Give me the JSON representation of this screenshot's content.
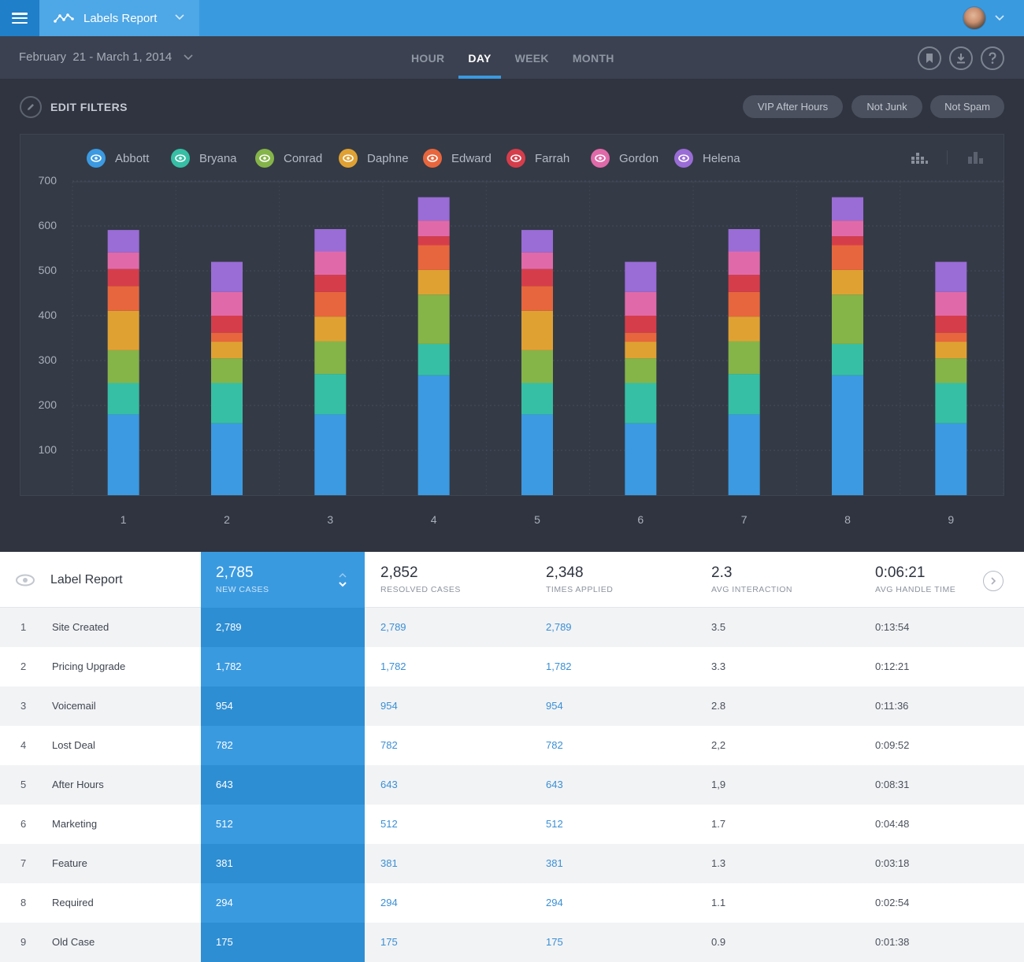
{
  "header": {
    "report_title": "Labels Report"
  },
  "subbar": {
    "date_range": "February  21 - March 1, 2014",
    "tabs": [
      {
        "label": "HOUR",
        "active": false
      },
      {
        "label": "DAY",
        "active": true
      },
      {
        "label": "WEEK",
        "active": false
      },
      {
        "label": "MONTH",
        "active": false
      }
    ],
    "icons": [
      "bookmark-icon",
      "download-icon",
      "help-icon"
    ]
  },
  "filters": {
    "edit_label": "EDIT FILTERS",
    "chips": [
      "VIP After Hours",
      "Not Junk",
      "Not Spam"
    ]
  },
  "colors": {
    "accent": "#3a9ae0",
    "series": [
      "#3b9ae1",
      "#36bfa4",
      "#85b449",
      "#e0a133",
      "#e8663d",
      "#d63d4b",
      "#e06aa9",
      "#9a6cd6"
    ]
  },
  "chart_data": {
    "type": "bar",
    "stacked": true,
    "categories": [
      "1",
      "2",
      "3",
      "4",
      "5",
      "6",
      "7",
      "8",
      "9"
    ],
    "ylim": [
      0,
      800
    ],
    "yticks": [
      100,
      200,
      300,
      400,
      500,
      600,
      700
    ],
    "grid": true,
    "legend_position": "top-left",
    "series": [
      {
        "name": "Abbott",
        "values": [
          180,
          160,
          180,
          267,
          180,
          160,
          180,
          267,
          160
        ]
      },
      {
        "name": "Bryana",
        "values": [
          70,
          90,
          90,
          70,
          70,
          90,
          90,
          70,
          90
        ]
      },
      {
        "name": "Conrad",
        "values": [
          73,
          55,
          73,
          110,
          73,
          55,
          73,
          110,
          55
        ]
      },
      {
        "name": "Daphne",
        "values": [
          88,
          37,
          55,
          55,
          88,
          37,
          55,
          55,
          37
        ]
      },
      {
        "name": "Edward",
        "values": [
          55,
          20,
          55,
          55,
          55,
          20,
          55,
          55,
          20
        ]
      },
      {
        "name": "Farrah",
        "values": [
          38,
          38,
          38,
          20,
          38,
          38,
          38,
          20,
          38
        ]
      },
      {
        "name": "Gordon",
        "values": [
          37,
          53,
          52,
          35,
          37,
          53,
          52,
          35,
          53
        ]
      },
      {
        "name": "Helena",
        "values": [
          50,
          67,
          50,
          52,
          50,
          67,
          50,
          52,
          67
        ]
      }
    ]
  },
  "table": {
    "title": "Label Report",
    "headers": [
      {
        "value": "2,785",
        "label": "NEW CASES"
      },
      {
        "value": "2,852",
        "label": "RESOLVED CASES"
      },
      {
        "value": "2,348",
        "label": "TIMES APPLIED"
      },
      {
        "value": "2.3",
        "label": "AVG INTERACTION"
      },
      {
        "value": "0:06:21",
        "label": "AVG HANDLE TIME"
      }
    ],
    "rows": [
      {
        "idx": "1",
        "name": "Site Created",
        "new": "2,789",
        "resolved": "2,789",
        "applied": "2,789",
        "avg": "3.5",
        "time": "0:13:54"
      },
      {
        "idx": "2",
        "name": "Pricing Upgrade",
        "new": "1,782",
        "resolved": "1,782",
        "applied": "1,782",
        "avg": "3.3",
        "time": "0:12:21"
      },
      {
        "idx": "3",
        "name": "Voicemail",
        "new": "954",
        "resolved": "954",
        "applied": "954",
        "avg": "2.8",
        "time": "0:11:36"
      },
      {
        "idx": "4",
        "name": "Lost Deal",
        "new": "782",
        "resolved": "782",
        "applied": "782",
        "avg": "2,2",
        "time": "0:09:52"
      },
      {
        "idx": "5",
        "name": "After Hours",
        "new": "643",
        "resolved": "643",
        "applied": "643",
        "avg": "1,9",
        "time": "0:08:31"
      },
      {
        "idx": "6",
        "name": "Marketing",
        "new": "512",
        "resolved": "512",
        "applied": "512",
        "avg": "1.7",
        "time": "0:04:48"
      },
      {
        "idx": "7",
        "name": "Feature",
        "new": "381",
        "resolved": "381",
        "applied": "381",
        "avg": "1.3",
        "time": "0:03:18"
      },
      {
        "idx": "8",
        "name": "Required",
        "new": "294",
        "resolved": "294",
        "applied": "294",
        "avg": "1.1",
        "time": "0:02:54"
      },
      {
        "idx": "9",
        "name": "Old Case",
        "new": "175",
        "resolved": "175",
        "applied": "175",
        "avg": "0.9",
        "time": "0:01:38"
      }
    ]
  }
}
